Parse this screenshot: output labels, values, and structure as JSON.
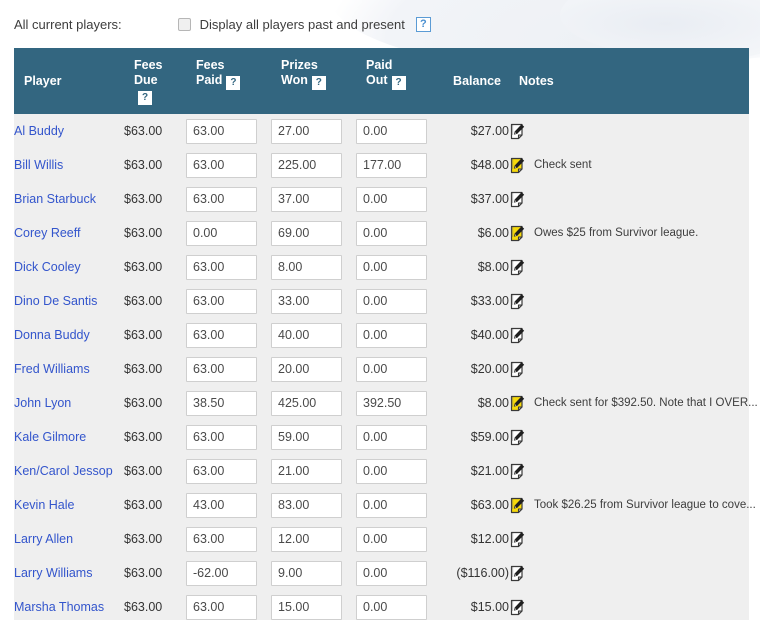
{
  "toolbar": {
    "label": "All current players:",
    "checkbox_label": "Display all players past and present",
    "checkbox_checked": false,
    "help_icon": "help-question-icon",
    "help_glyph": "?"
  },
  "table": {
    "header_bg": "#336680",
    "row_bg": "#efefef",
    "link_color": "#3355cc",
    "positive_color": "#1a9a3c",
    "negative_color": "#e03b3b",
    "columns": [
      {
        "key": "player",
        "label": "Player",
        "label2": "",
        "help": false
      },
      {
        "key": "fees_due",
        "label": "Fees",
        "label2": "Due",
        "help": true
      },
      {
        "key": "fees_paid",
        "label": "Fees",
        "label2": "Paid",
        "help": true
      },
      {
        "key": "prizes_won",
        "label": "Prizes",
        "label2": "Won",
        "help": true
      },
      {
        "key": "paid_out",
        "label": "Paid",
        "label2": "Out",
        "help": true
      },
      {
        "key": "balance",
        "label": "Balance",
        "label2": "",
        "help": false
      },
      {
        "key": "notes",
        "label": "Notes",
        "label2": "",
        "help": false
      }
    ],
    "help_glyph": "?",
    "rows": [
      {
        "player": "Al Buddy",
        "fees_due": "$63.00",
        "fees_paid": "63.00",
        "prizes_won": "27.00",
        "paid_out": "0.00",
        "balance": "$27.00",
        "balance_sign": "pos",
        "note_filled": false,
        "note": ""
      },
      {
        "player": "Bill Willis",
        "fees_due": "$63.00",
        "fees_paid": "63.00",
        "prizes_won": "225.00",
        "paid_out": "177.00",
        "balance": "$48.00",
        "balance_sign": "pos",
        "note_filled": true,
        "note": "Check sent"
      },
      {
        "player": "Brian Starbuck",
        "fees_due": "$63.00",
        "fees_paid": "63.00",
        "prizes_won": "37.00",
        "paid_out": "0.00",
        "balance": "$37.00",
        "balance_sign": "pos",
        "note_filled": false,
        "note": ""
      },
      {
        "player": "Corey Reeff",
        "fees_due": "$63.00",
        "fees_paid": "0.00",
        "prizes_won": "69.00",
        "paid_out": "0.00",
        "balance": "$6.00",
        "balance_sign": "pos",
        "note_filled": true,
        "note": "Owes $25 from Survivor league."
      },
      {
        "player": "Dick Cooley",
        "fees_due": "$63.00",
        "fees_paid": "63.00",
        "prizes_won": "8.00",
        "paid_out": "0.00",
        "balance": "$8.00",
        "balance_sign": "pos",
        "note_filled": false,
        "note": ""
      },
      {
        "player": "Dino De Santis",
        "fees_due": "$63.00",
        "fees_paid": "63.00",
        "prizes_won": "33.00",
        "paid_out": "0.00",
        "balance": "$33.00",
        "balance_sign": "pos",
        "note_filled": false,
        "note": ""
      },
      {
        "player": "Donna Buddy",
        "fees_due": "$63.00",
        "fees_paid": "63.00",
        "prizes_won": "40.00",
        "paid_out": "0.00",
        "balance": "$40.00",
        "balance_sign": "pos",
        "note_filled": false,
        "note": ""
      },
      {
        "player": "Fred Williams",
        "fees_due": "$63.00",
        "fees_paid": "63.00",
        "prizes_won": "20.00",
        "paid_out": "0.00",
        "balance": "$20.00",
        "balance_sign": "pos",
        "note_filled": false,
        "note": ""
      },
      {
        "player": "John Lyon",
        "fees_due": "$63.00",
        "fees_paid": "38.50",
        "prizes_won": "425.00",
        "paid_out": "392.50",
        "balance": "$8.00",
        "balance_sign": "pos",
        "note_filled": true,
        "note": "Check sent for $392.50. Note that I OVER..."
      },
      {
        "player": "Kale Gilmore",
        "fees_due": "$63.00",
        "fees_paid": "63.00",
        "prizes_won": "59.00",
        "paid_out": "0.00",
        "balance": "$59.00",
        "balance_sign": "pos",
        "note_filled": false,
        "note": ""
      },
      {
        "player": "Ken/Carol Jessop",
        "fees_due": "$63.00",
        "fees_paid": "63.00",
        "prizes_won": "21.00",
        "paid_out": "0.00",
        "balance": "$21.00",
        "balance_sign": "pos",
        "note_filled": false,
        "note": ""
      },
      {
        "player": "Kevin Hale",
        "fees_due": "$63.00",
        "fees_paid": "43.00",
        "prizes_won": "83.00",
        "paid_out": "0.00",
        "balance": "$63.00",
        "balance_sign": "pos",
        "note_filled": true,
        "note": "Took $26.25 from Survivor league to cove..."
      },
      {
        "player": "Larry Allen",
        "fees_due": "$63.00",
        "fees_paid": "63.00",
        "prizes_won": "12.00",
        "paid_out": "0.00",
        "balance": "$12.00",
        "balance_sign": "pos",
        "note_filled": false,
        "note": ""
      },
      {
        "player": "Larry Williams",
        "fees_due": "$63.00",
        "fees_paid": "-62.00",
        "prizes_won": "9.00",
        "paid_out": "0.00",
        "balance": "($116.00)",
        "balance_sign": "neg",
        "note_filled": false,
        "note": ""
      },
      {
        "player": "Marsha Thomas",
        "fees_due": "$63.00",
        "fees_paid": "63.00",
        "prizes_won": "15.00",
        "paid_out": "0.00",
        "balance": "$15.00",
        "balance_sign": "pos",
        "note_filled": false,
        "note": ""
      }
    ]
  }
}
